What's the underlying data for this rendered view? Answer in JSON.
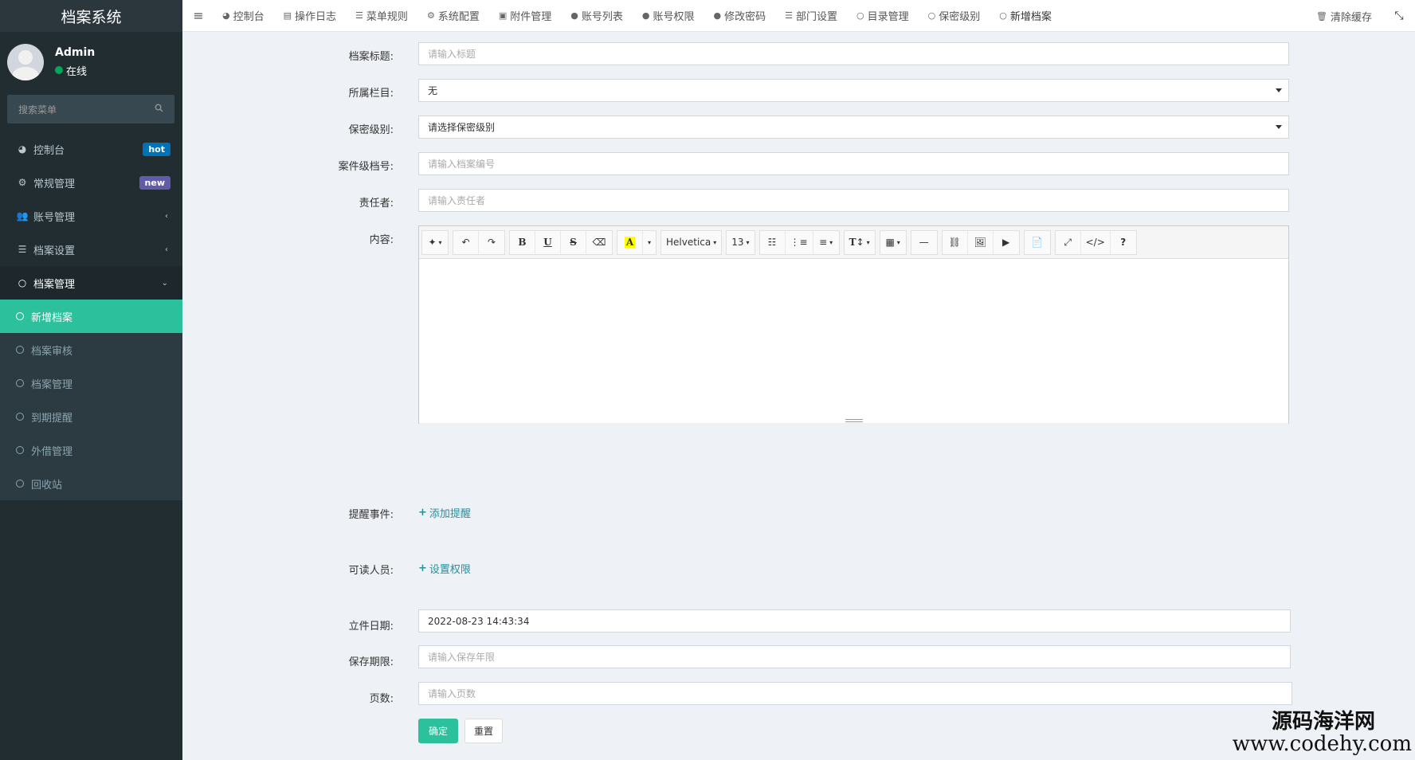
{
  "sidebar": {
    "brand": "档案系统",
    "user": {
      "name": "Admin",
      "status": "在线"
    },
    "search": {
      "placeholder": "搜索菜单",
      "icon": "search-icon"
    },
    "menu": [
      {
        "label": "控制台",
        "icon": "dashboard-icon",
        "badge": "hot"
      },
      {
        "label": "常规管理",
        "icon": "cogs-icon",
        "badge": "new"
      },
      {
        "label": "账号管理",
        "icon": "users-icon",
        "arrow": "‹"
      },
      {
        "label": "档案设置",
        "icon": "list-icon",
        "arrow": "‹"
      },
      {
        "label": "档案管理",
        "icon": "circle-icon",
        "arrow": "⌄"
      }
    ],
    "submenu": [
      {
        "label": "新增档案",
        "active": true
      },
      {
        "label": "档案审核"
      },
      {
        "label": "档案管理"
      },
      {
        "label": "到期提醒"
      },
      {
        "label": "外借管理"
      },
      {
        "label": "回收站"
      }
    ]
  },
  "topbar": {
    "tabs": [
      {
        "label": "控制台",
        "icon": "dashboard-icon"
      },
      {
        "label": "操作日志",
        "icon": "log-icon"
      },
      {
        "label": "菜单规则",
        "icon": "list-icon"
      },
      {
        "label": "系统配置",
        "icon": "gear-icon"
      },
      {
        "label": "附件管理",
        "icon": "file-image-icon"
      },
      {
        "label": "账号列表",
        "icon": "user-icon"
      },
      {
        "label": "账号权限",
        "icon": "group-icon"
      },
      {
        "label": "修改密码",
        "icon": "user-icon"
      },
      {
        "label": "部门设置",
        "icon": "list-icon"
      },
      {
        "label": "目录管理",
        "icon": "circle-icon"
      },
      {
        "label": "保密级别",
        "icon": "circle-icon"
      },
      {
        "label": "新增档案",
        "icon": "circle-icon"
      }
    ],
    "clear_cache": "清除缓存",
    "fullscreen_icon": "expand-icon"
  },
  "form": {
    "title": {
      "label": "档案标题:",
      "placeholder": "请输入标题"
    },
    "column": {
      "label": "所属栏目:",
      "value": "无"
    },
    "secret_level": {
      "label": "保密级别:",
      "value": "请选择保密级别"
    },
    "file_number": {
      "label": "案件级档号:",
      "placeholder": "请输入档案编号"
    },
    "owner": {
      "label": "责任者:",
      "placeholder": "请输入责任者"
    },
    "content": {
      "label": "内容:",
      "font_name": "Helvetica",
      "font_size": "13"
    },
    "reminder": {
      "label": "提醒事件:",
      "link": "添加提醒"
    },
    "readers": {
      "label": "可读人员:",
      "link": "设置权限"
    },
    "date": {
      "label": "立件日期:",
      "value": "2022-08-23 14:43:34"
    },
    "retention": {
      "label": "保存期限:",
      "placeholder": "请输入保存年限"
    },
    "pages": {
      "label": "页数:",
      "placeholder": "请输入页数"
    },
    "submit": "确定",
    "reset": "重置"
  },
  "watermark": {
    "name": "源码海洋网",
    "url": "www.codehy.com"
  },
  "colors": {
    "sidebar_bg": "#222d32",
    "accent": "#2cc09c",
    "badge_hot": "#0073b7",
    "badge_new": "#605ca8",
    "link": "#2b8d9c"
  }
}
